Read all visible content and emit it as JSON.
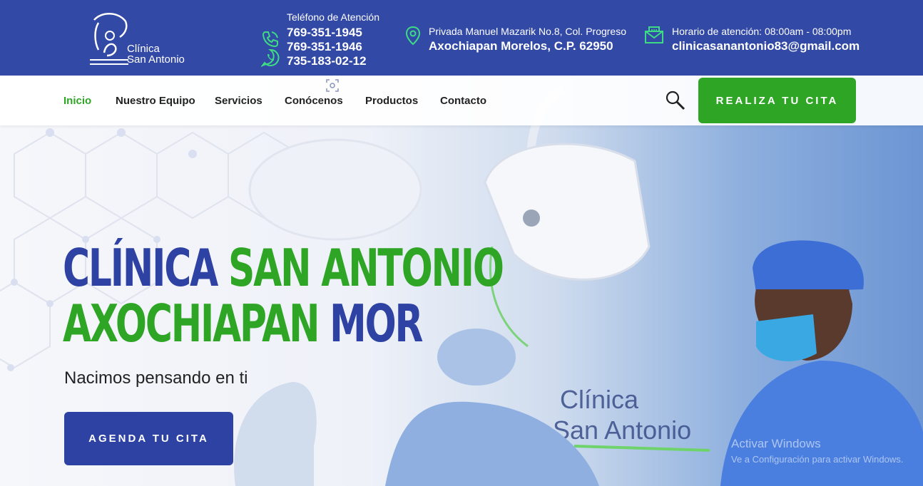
{
  "brand": {
    "logo_line1": "Clínica",
    "logo_line2": "San Antonio"
  },
  "contact": {
    "phone_label": "Teléfono de Atención",
    "phones": [
      "769-351-1945",
      "769-351-1946",
      "735-183-02-12"
    ],
    "address_line1": "Privada Manuel Mazarik No.8, Col. Progreso",
    "address_line2": "Axochiapan Morelos, C.P. 62950",
    "hours": "Horario de atención: 08:00am - 08:00pm",
    "email": "clinicasanantonio83@gmail.com"
  },
  "nav": {
    "items": [
      {
        "label": "Inicio",
        "active": true
      },
      {
        "label": "Nuestro Equipo",
        "active": false
      },
      {
        "label": "Servicios",
        "active": false
      },
      {
        "label": "Conócenos",
        "active": false
      },
      {
        "label": "Productos",
        "active": false
      },
      {
        "label": "Contacto",
        "active": false
      }
    ],
    "cta_label": "REALIZA TU CITA"
  },
  "hero": {
    "title_line1_a": "CLÍNICA",
    "title_line1_b": "SAN ANTONIO",
    "title_line2_a": "AXOCHIAPAN",
    "title_line2_b": "MOR",
    "subtitle": "Nacimos pensando en ti",
    "button_label": "AGENDA TU CITA",
    "background_sign_line1": "Clínica",
    "background_sign_line2": "San Antonio"
  },
  "os_overlay": {
    "line1": "Activar Windows",
    "line2": "Ve a Configuración para activar Windows."
  },
  "colors": {
    "topbar": "#3249a6",
    "brand_blue": "#2d42a3",
    "brand_green": "#2fa526"
  }
}
